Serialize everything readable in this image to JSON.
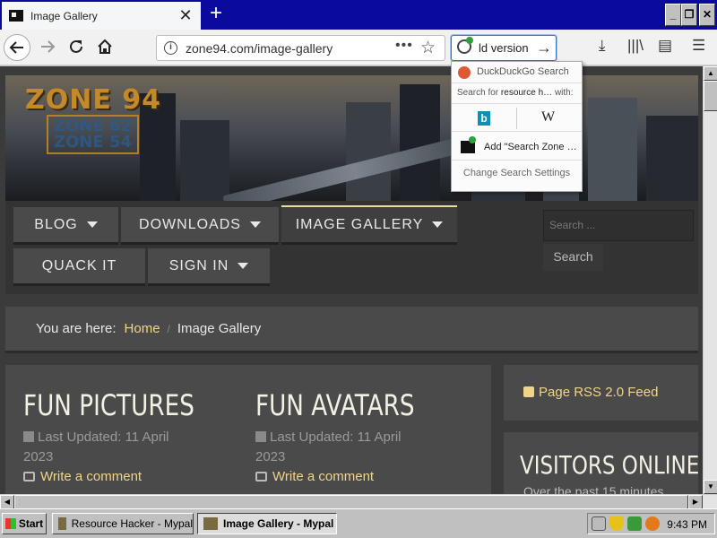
{
  "browser": {
    "tab_title": "Image Gallery",
    "tab_close": "✕",
    "new_tab": "+",
    "url": "zone94.com/image-gallery",
    "search_value": "ld version",
    "window_buttons": {
      "minimize": "_",
      "restore": "❐",
      "close": "✕"
    }
  },
  "search_dropdown": {
    "engine": "DuckDuckGo Search",
    "search_for_prefix": "Search for",
    "search_for_term": "resource h…",
    "search_for_suffix": "with:",
    "bing": "b",
    "wikipedia": "W",
    "add_engine": "Add \"Search Zone …",
    "settings": "Change Search Settings"
  },
  "site": {
    "logo": "ZONE 94",
    "logo_sub": [
      "ZONE 62",
      "ZONE 54"
    ],
    "menu": [
      {
        "label": "BLOG",
        "has_caret": true
      },
      {
        "label": "DOWNLOADS",
        "has_caret": true
      },
      {
        "label": "IMAGE GALLERY",
        "has_caret": true,
        "active": true
      },
      {
        "label": "QUACK IT",
        "has_caret": false
      },
      {
        "label": "SIGN IN",
        "has_caret": true
      }
    ],
    "search_placeholder": "Search ...",
    "search_button": "Search",
    "breadcrumb": {
      "prefix": "You are here:",
      "home": "Home",
      "separator": "/",
      "current": "Image Gallery"
    },
    "articles": [
      {
        "title": "FUN PICTURES",
        "updated": "Last Updated: 11 April 2023",
        "comment": "Write a comment"
      },
      {
        "title": "FUN AVATARS",
        "updated": "Last Updated: 11 April 2023",
        "comment": "Write a comment"
      }
    ],
    "rss": "Page RSS 2.0 Feed",
    "visitors_title": "VISITORS ONLINE",
    "visitors_sub": "Over the past 15 minutes"
  },
  "taskbar": {
    "start": "Start",
    "tasks": [
      {
        "label": "Resource Hacker - Mypal",
        "active": false
      },
      {
        "label": "Image Gallery - Mypal",
        "active": true
      }
    ],
    "clock": "9:43 PM"
  },
  "colors": {
    "titlebar": "#0a0a9e",
    "accent_link": "#efd48a",
    "site_panel": "#4a4a4a",
    "site_bg": "#3b3b3b"
  }
}
